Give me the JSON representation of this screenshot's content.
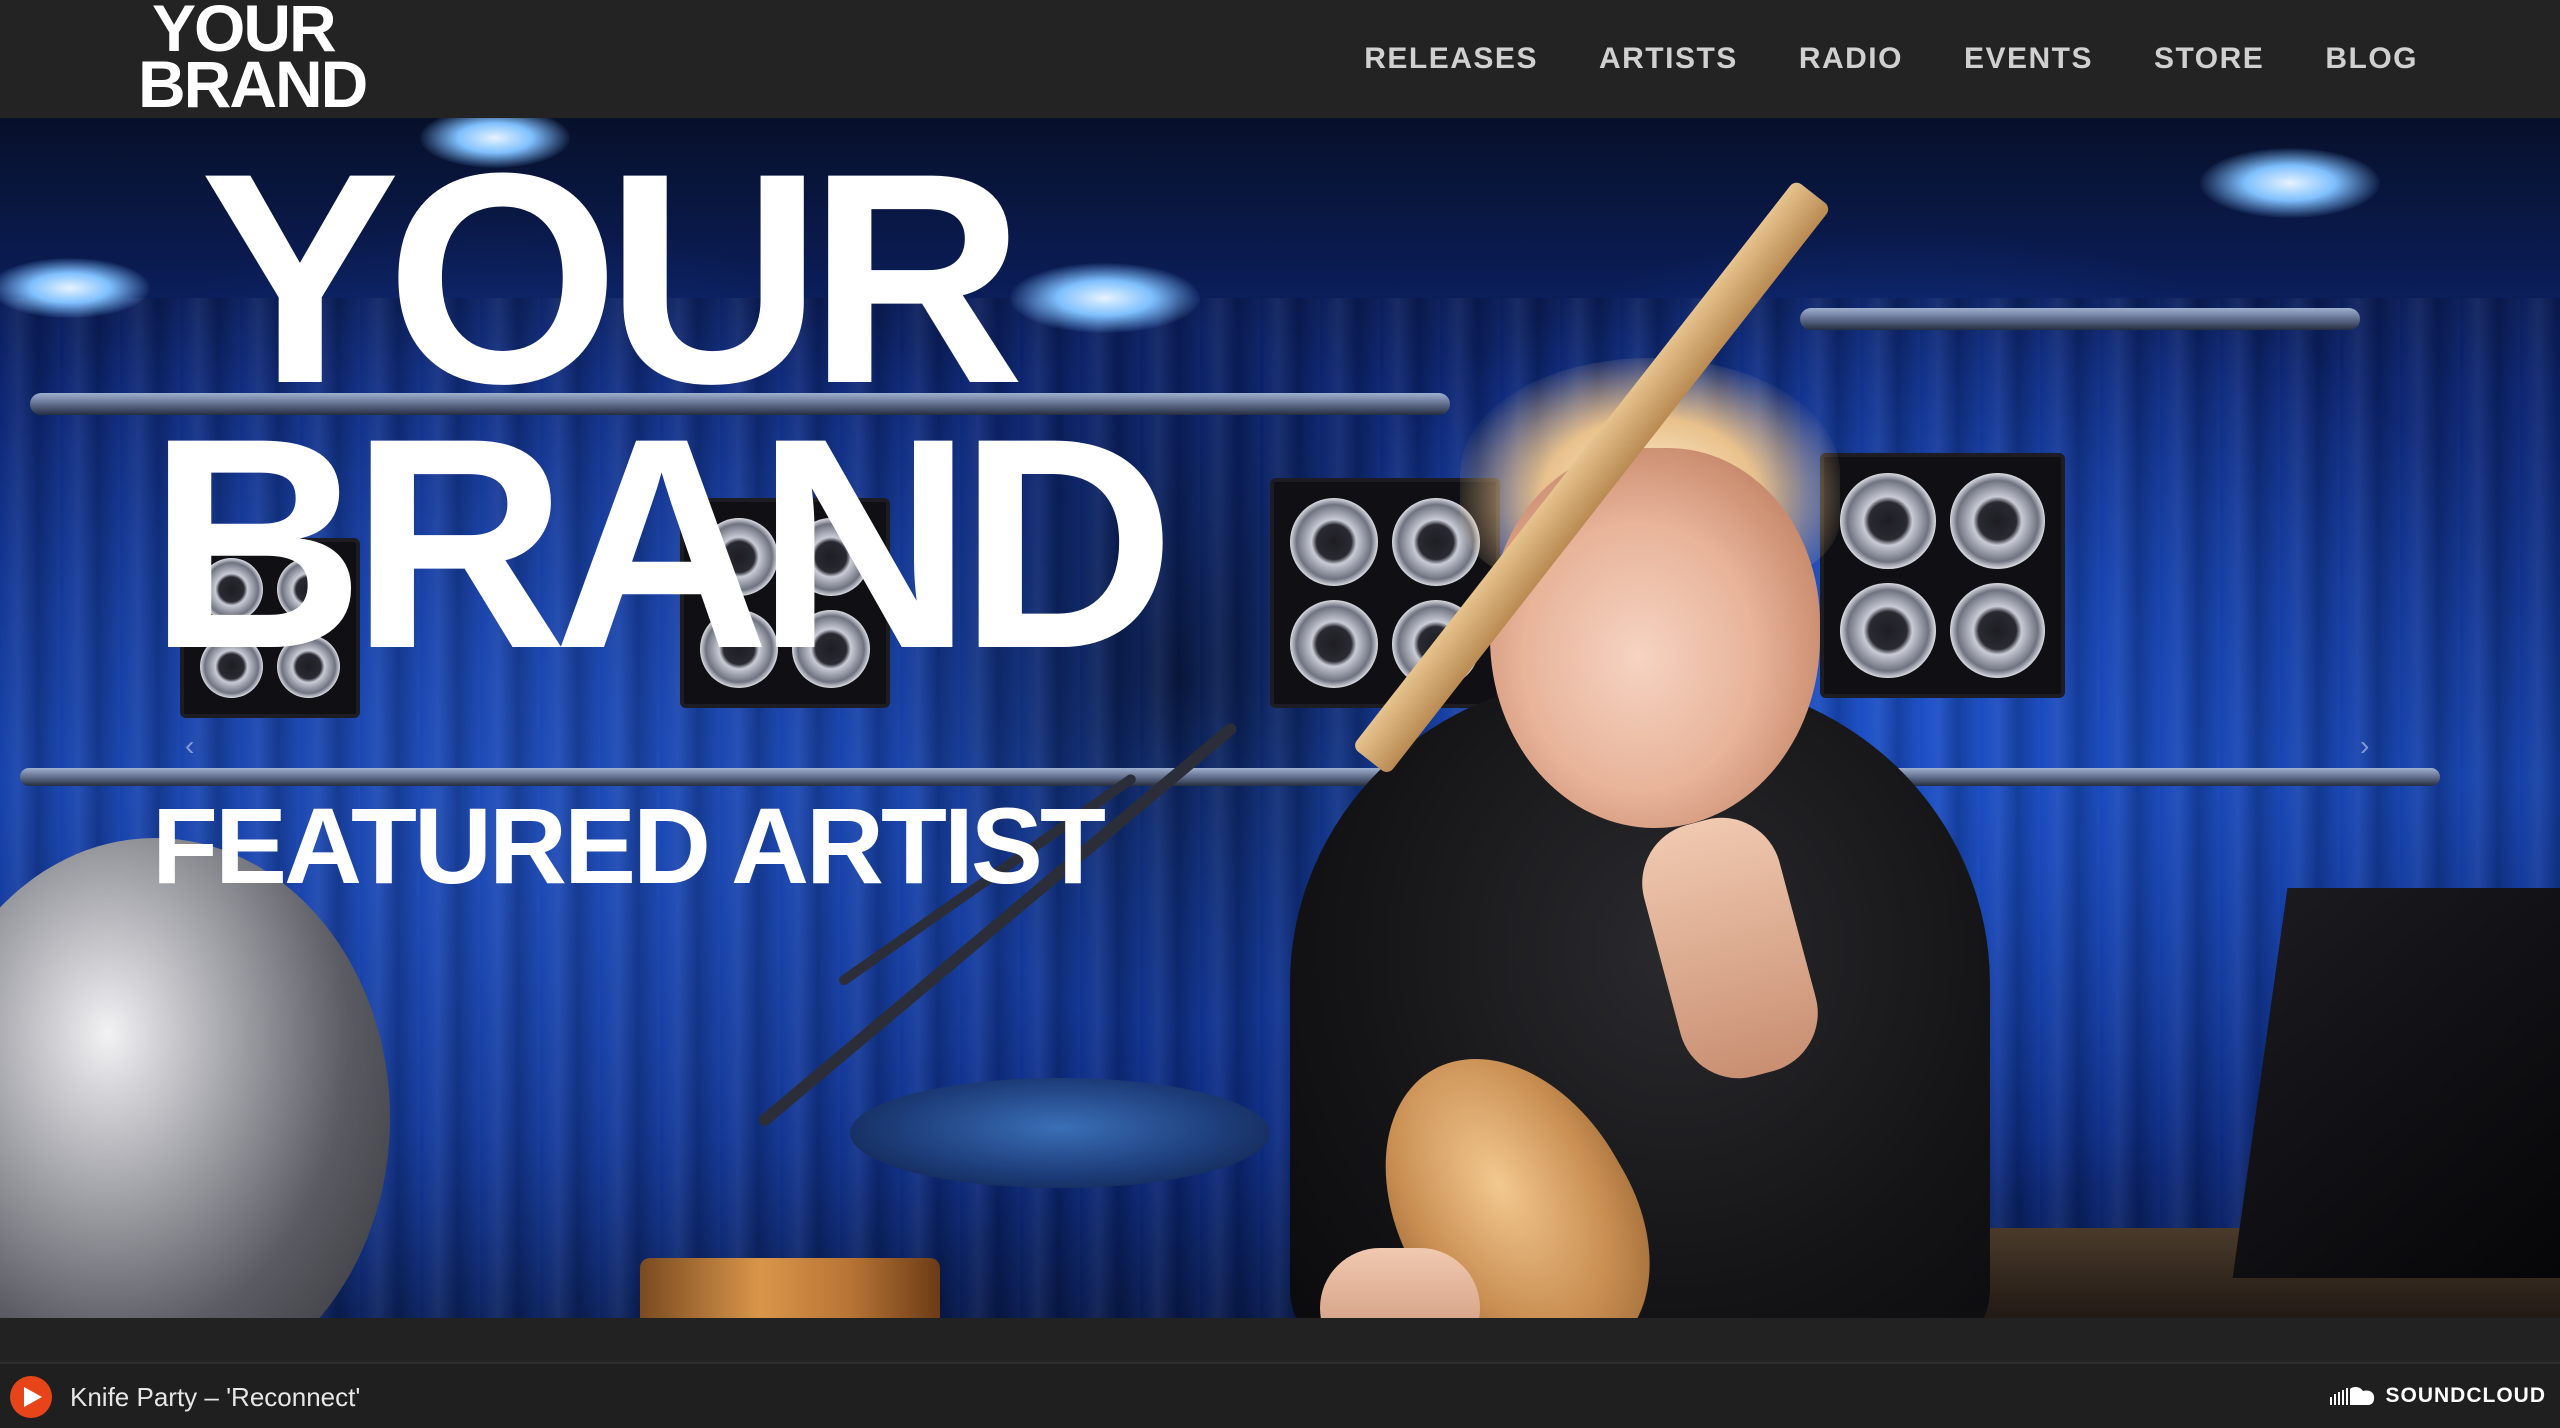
{
  "brand": {
    "line1": "YOUR",
    "line2": "BRAND"
  },
  "nav": {
    "items": [
      {
        "label": "RELEASES"
      },
      {
        "label": "ARTISTS"
      },
      {
        "label": "RADIO"
      },
      {
        "label": "EVENTS"
      },
      {
        "label": "STORE"
      },
      {
        "label": "BLOG"
      }
    ]
  },
  "hero": {
    "title_line1": "YOUR",
    "title_line2": "BRAND",
    "subtitle": "FEATURED ARTIST",
    "prev_arrow": "‹",
    "next_arrow": "›"
  },
  "player": {
    "track": "Knife Party – 'Reconnect'",
    "provider": "SOUNDCLOUD",
    "play_icon": "play-icon",
    "provider_icon": "soundcloud-icon",
    "accent_color": "#e8441a"
  }
}
